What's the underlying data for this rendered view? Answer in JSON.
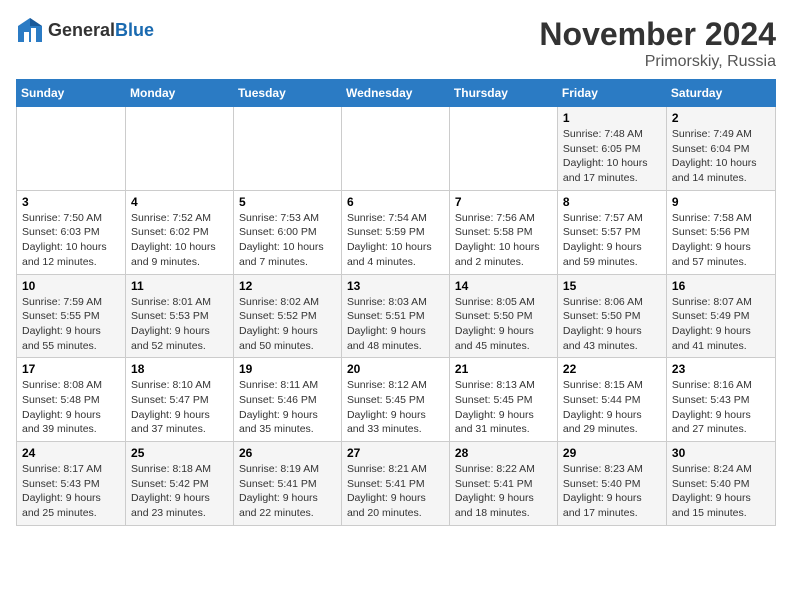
{
  "logo": {
    "general": "General",
    "blue": "Blue"
  },
  "title": {
    "month": "November 2024",
    "location": "Primorskiy, Russia"
  },
  "headers": [
    "Sunday",
    "Monday",
    "Tuesday",
    "Wednesday",
    "Thursday",
    "Friday",
    "Saturday"
  ],
  "weeks": [
    [
      {
        "day": "",
        "sunrise": "",
        "sunset": "",
        "daylight": ""
      },
      {
        "day": "",
        "sunrise": "",
        "sunset": "",
        "daylight": ""
      },
      {
        "day": "",
        "sunrise": "",
        "sunset": "",
        "daylight": ""
      },
      {
        "day": "",
        "sunrise": "",
        "sunset": "",
        "daylight": ""
      },
      {
        "day": "",
        "sunrise": "",
        "sunset": "",
        "daylight": ""
      },
      {
        "day": "1",
        "sunrise": "Sunrise: 7:48 AM",
        "sunset": "Sunset: 6:05 PM",
        "daylight": "Daylight: 10 hours and 17 minutes."
      },
      {
        "day": "2",
        "sunrise": "Sunrise: 7:49 AM",
        "sunset": "Sunset: 6:04 PM",
        "daylight": "Daylight: 10 hours and 14 minutes."
      }
    ],
    [
      {
        "day": "3",
        "sunrise": "Sunrise: 7:50 AM",
        "sunset": "Sunset: 6:03 PM",
        "daylight": "Daylight: 10 hours and 12 minutes."
      },
      {
        "day": "4",
        "sunrise": "Sunrise: 7:52 AM",
        "sunset": "Sunset: 6:02 PM",
        "daylight": "Daylight: 10 hours and 9 minutes."
      },
      {
        "day": "5",
        "sunrise": "Sunrise: 7:53 AM",
        "sunset": "Sunset: 6:00 PM",
        "daylight": "Daylight: 10 hours and 7 minutes."
      },
      {
        "day": "6",
        "sunrise": "Sunrise: 7:54 AM",
        "sunset": "Sunset: 5:59 PM",
        "daylight": "Daylight: 10 hours and 4 minutes."
      },
      {
        "day": "7",
        "sunrise": "Sunrise: 7:56 AM",
        "sunset": "Sunset: 5:58 PM",
        "daylight": "Daylight: 10 hours and 2 minutes."
      },
      {
        "day": "8",
        "sunrise": "Sunrise: 7:57 AM",
        "sunset": "Sunset: 5:57 PM",
        "daylight": "Daylight: 9 hours and 59 minutes."
      },
      {
        "day": "9",
        "sunrise": "Sunrise: 7:58 AM",
        "sunset": "Sunset: 5:56 PM",
        "daylight": "Daylight: 9 hours and 57 minutes."
      }
    ],
    [
      {
        "day": "10",
        "sunrise": "Sunrise: 7:59 AM",
        "sunset": "Sunset: 5:55 PM",
        "daylight": "Daylight: 9 hours and 55 minutes."
      },
      {
        "day": "11",
        "sunrise": "Sunrise: 8:01 AM",
        "sunset": "Sunset: 5:53 PM",
        "daylight": "Daylight: 9 hours and 52 minutes."
      },
      {
        "day": "12",
        "sunrise": "Sunrise: 8:02 AM",
        "sunset": "Sunset: 5:52 PM",
        "daylight": "Daylight: 9 hours and 50 minutes."
      },
      {
        "day": "13",
        "sunrise": "Sunrise: 8:03 AM",
        "sunset": "Sunset: 5:51 PM",
        "daylight": "Daylight: 9 hours and 48 minutes."
      },
      {
        "day": "14",
        "sunrise": "Sunrise: 8:05 AM",
        "sunset": "Sunset: 5:50 PM",
        "daylight": "Daylight: 9 hours and 45 minutes."
      },
      {
        "day": "15",
        "sunrise": "Sunrise: 8:06 AM",
        "sunset": "Sunset: 5:50 PM",
        "daylight": "Daylight: 9 hours and 43 minutes."
      },
      {
        "day": "16",
        "sunrise": "Sunrise: 8:07 AM",
        "sunset": "Sunset: 5:49 PM",
        "daylight": "Daylight: 9 hours and 41 minutes."
      }
    ],
    [
      {
        "day": "17",
        "sunrise": "Sunrise: 8:08 AM",
        "sunset": "Sunset: 5:48 PM",
        "daylight": "Daylight: 9 hours and 39 minutes."
      },
      {
        "day": "18",
        "sunrise": "Sunrise: 8:10 AM",
        "sunset": "Sunset: 5:47 PM",
        "daylight": "Daylight: 9 hours and 37 minutes."
      },
      {
        "day": "19",
        "sunrise": "Sunrise: 8:11 AM",
        "sunset": "Sunset: 5:46 PM",
        "daylight": "Daylight: 9 hours and 35 minutes."
      },
      {
        "day": "20",
        "sunrise": "Sunrise: 8:12 AM",
        "sunset": "Sunset: 5:45 PM",
        "daylight": "Daylight: 9 hours and 33 minutes."
      },
      {
        "day": "21",
        "sunrise": "Sunrise: 8:13 AM",
        "sunset": "Sunset: 5:45 PM",
        "daylight": "Daylight: 9 hours and 31 minutes."
      },
      {
        "day": "22",
        "sunrise": "Sunrise: 8:15 AM",
        "sunset": "Sunset: 5:44 PM",
        "daylight": "Daylight: 9 hours and 29 minutes."
      },
      {
        "day": "23",
        "sunrise": "Sunrise: 8:16 AM",
        "sunset": "Sunset: 5:43 PM",
        "daylight": "Daylight: 9 hours and 27 minutes."
      }
    ],
    [
      {
        "day": "24",
        "sunrise": "Sunrise: 8:17 AM",
        "sunset": "Sunset: 5:43 PM",
        "daylight": "Daylight: 9 hours and 25 minutes."
      },
      {
        "day": "25",
        "sunrise": "Sunrise: 8:18 AM",
        "sunset": "Sunset: 5:42 PM",
        "daylight": "Daylight: 9 hours and 23 minutes."
      },
      {
        "day": "26",
        "sunrise": "Sunrise: 8:19 AM",
        "sunset": "Sunset: 5:41 PM",
        "daylight": "Daylight: 9 hours and 22 minutes."
      },
      {
        "day": "27",
        "sunrise": "Sunrise: 8:21 AM",
        "sunset": "Sunset: 5:41 PM",
        "daylight": "Daylight: 9 hours and 20 minutes."
      },
      {
        "day": "28",
        "sunrise": "Sunrise: 8:22 AM",
        "sunset": "Sunset: 5:41 PM",
        "daylight": "Daylight: 9 hours and 18 minutes."
      },
      {
        "day": "29",
        "sunrise": "Sunrise: 8:23 AM",
        "sunset": "Sunset: 5:40 PM",
        "daylight": "Daylight: 9 hours and 17 minutes."
      },
      {
        "day": "30",
        "sunrise": "Sunrise: 8:24 AM",
        "sunset": "Sunset: 5:40 PM",
        "daylight": "Daylight: 9 hours and 15 minutes."
      }
    ]
  ]
}
